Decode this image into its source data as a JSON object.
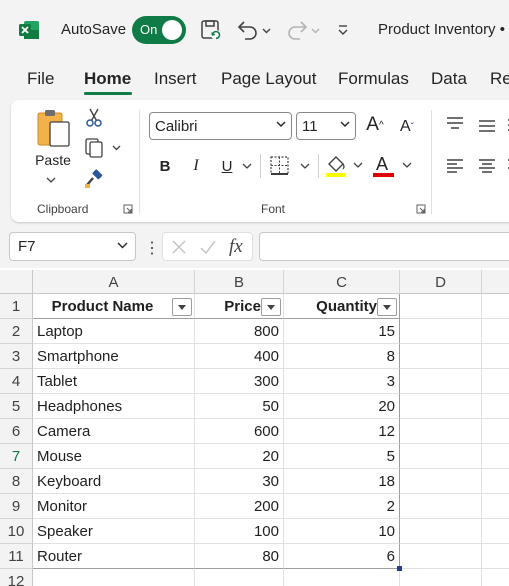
{
  "titlebar": {
    "autosave_label": "AutoSave",
    "autosave_state": "On",
    "doc_title": "Product Inventory •",
    "accent_color": "#0f7b46"
  },
  "tabs": [
    "File",
    "Home",
    "Insert",
    "Page Layout",
    "Formulas",
    "Data",
    "Re"
  ],
  "active_tab": "Home",
  "ribbon": {
    "clipboard": {
      "paste_label": "Paste",
      "group_label": "Clipboard"
    },
    "font": {
      "font_name": "Calibri",
      "font_size": "11",
      "bold": "B",
      "italic": "I",
      "underline": "U",
      "font_color_letter": "A",
      "grow": "A",
      "shrink": "A",
      "group_label": "Font",
      "highlight_color": "#ffff00",
      "font_color": "#e00000"
    }
  },
  "formula_bar": {
    "name_box": "F7",
    "fx_label": "fx",
    "formula": ""
  },
  "sheet": {
    "columns": [
      "A",
      "B",
      "C",
      "D"
    ],
    "row_numbers": [
      "1",
      "2",
      "3",
      "4",
      "5",
      "6",
      "7",
      "8",
      "9",
      "10",
      "11",
      "12"
    ],
    "active_row": "7",
    "headers": [
      "Product Name",
      "Price",
      "Quantity"
    ],
    "rows": [
      [
        "Laptop",
        "800",
        "15"
      ],
      [
        "Smartphone",
        "400",
        "8"
      ],
      [
        "Tablet",
        "300",
        "3"
      ],
      [
        "Headphones",
        "50",
        "20"
      ],
      [
        "Camera",
        "600",
        "12"
      ],
      [
        "Mouse",
        "20",
        "5"
      ],
      [
        "Keyboard",
        "30",
        "18"
      ],
      [
        "Monitor",
        "200",
        "2"
      ],
      [
        "Speaker",
        "100",
        "10"
      ],
      [
        "Router",
        "80",
        "6"
      ]
    ]
  }
}
